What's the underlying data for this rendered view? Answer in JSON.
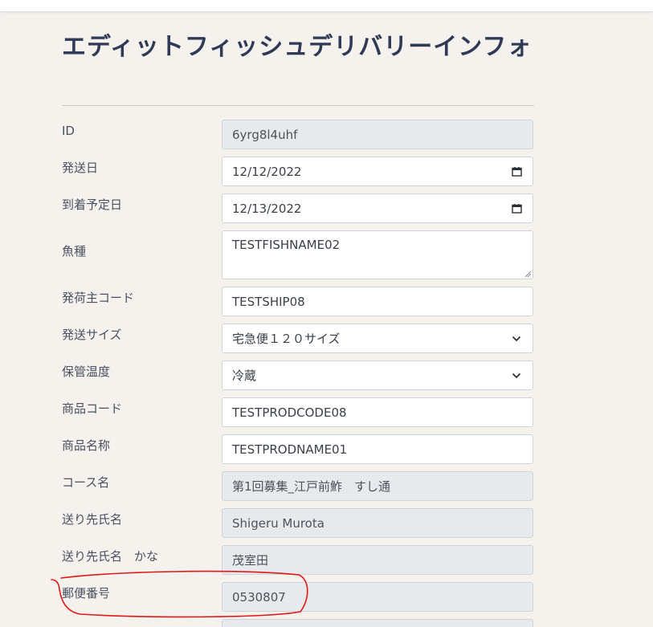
{
  "page": {
    "title": "エディットフィッシュデリバリーインフォ"
  },
  "form": {
    "fields": [
      {
        "label": "ID",
        "value": "6yrg8l4uhf",
        "readonly": true
      },
      {
        "label": "発送日",
        "value": "12/12/2022",
        "icon": "calendar-icon"
      },
      {
        "label": "到着予定日",
        "value": "12/13/2022",
        "icon": "calendar-icon"
      },
      {
        "label": "魚種",
        "value": "TESTFISHNAME02"
      },
      {
        "label": "発荷主コード",
        "value": "TESTSHIP08"
      },
      {
        "label": "発送サイズ",
        "value": "宅急便１２０サイズ",
        "icon": "chevron-down-icon"
      },
      {
        "label": "保管温度",
        "value": "冷蔵",
        "icon": "chevron-down-icon"
      },
      {
        "label": "商品コード",
        "value": "TESTPRODCODE08"
      },
      {
        "label": "商品名称",
        "value": "TESTPRODNAME01"
      },
      {
        "label": "コース名",
        "value": "第1回募集_江戸前鮓　すし通",
        "readonly": true
      },
      {
        "label": "送り先氏名",
        "value": "Shigeru Murota",
        "readonly": true
      },
      {
        "label": "送り先氏名　かな",
        "value": "茂室田",
        "readonly": true
      },
      {
        "label": "郵便番号",
        "value": "0530807",
        "readonly": true
      }
    ]
  },
  "colors": {
    "background": "#f5f2ee",
    "title": "#2e3a56",
    "annotation": "#e01818"
  }
}
